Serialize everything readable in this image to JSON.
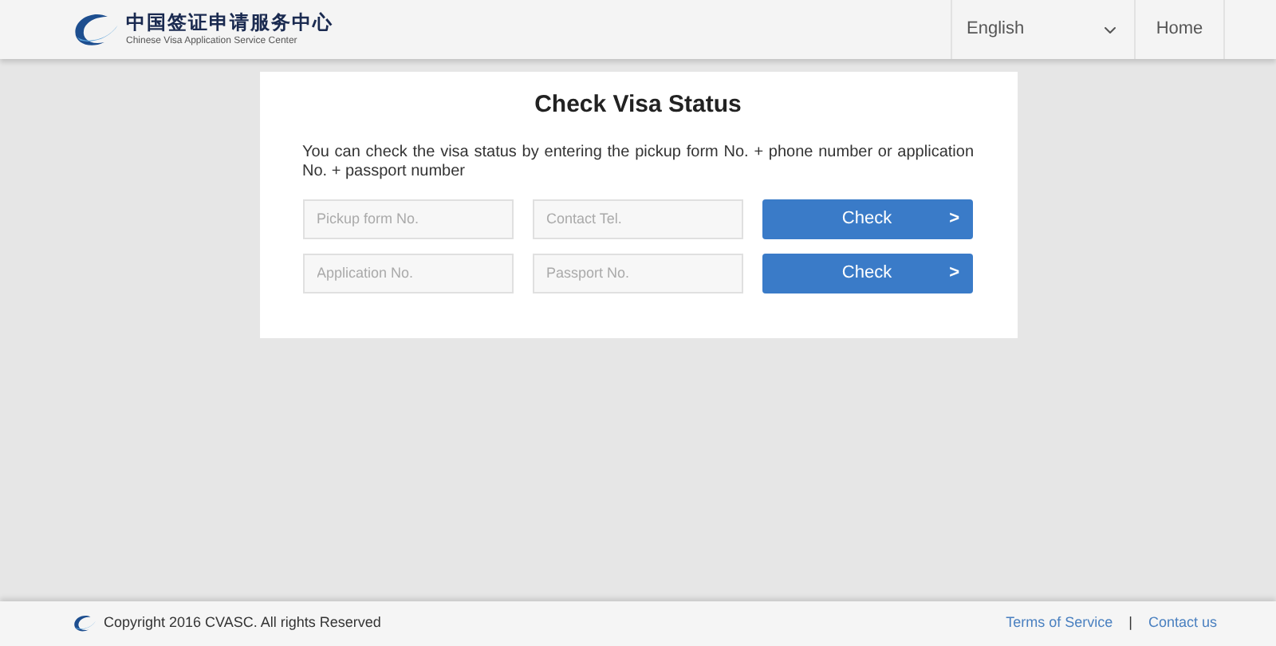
{
  "header": {
    "logo_title": "中国签证申请服务中心",
    "logo_subtitle": "Chinese Visa Application Service Center",
    "language": "English",
    "nav": [
      "Home"
    ]
  },
  "card": {
    "title": "Check Visa Status",
    "description": "You can check the visa status by entering the pickup form No. + phone number or application No. + passport number",
    "rows": [
      {
        "fields": [
          {
            "placeholder": "Pickup form No."
          },
          {
            "placeholder": "Contact Tel."
          }
        ],
        "button": "Check",
        "button_icon": ">"
      },
      {
        "fields": [
          {
            "placeholder": "Application No."
          },
          {
            "placeholder": "Passport No."
          }
        ],
        "button": "Check",
        "button_icon": ">"
      }
    ]
  },
  "footer": {
    "copyright": "Copyright 2016 CVASC. All rights Reserved",
    "links": [
      "Terms of Service",
      "Contact us"
    ],
    "separator": "|"
  }
}
